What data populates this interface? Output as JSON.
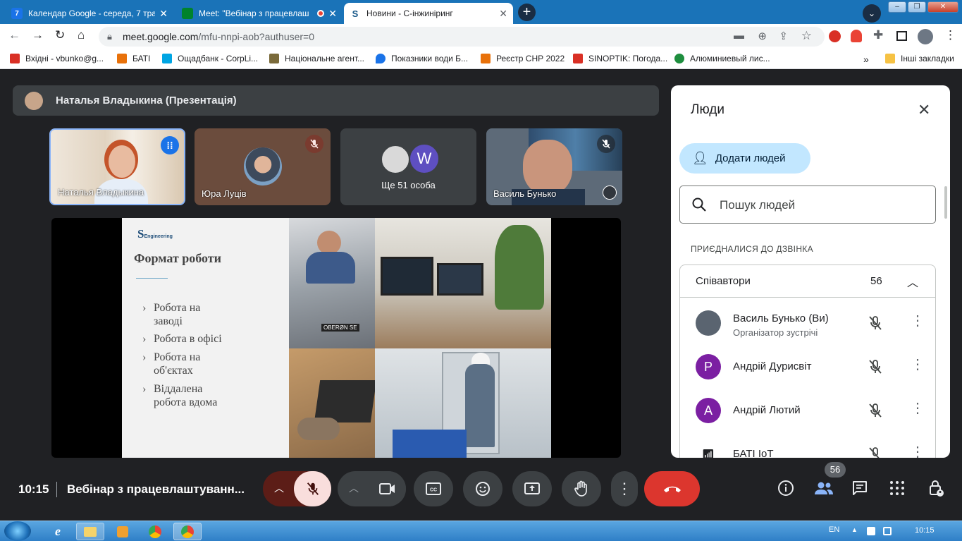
{
  "browser": {
    "tabs": [
      {
        "title": "Календар Google - середа, 7 тра",
        "favicon_text": "7",
        "favicon_color": "#1a73e8"
      },
      {
        "title": "Meet: \"Вебінар з працевлаш",
        "favicon_color": "#00832d"
      },
      {
        "title": "Новини - С-інжиніринг",
        "favicon_text": "S",
        "favicon_color": "#ffffff"
      }
    ],
    "new_tab_icon": "plus-icon",
    "url_host": "meet.google.com",
    "url_path": "/mfu-nnpi-aob?authuser=0",
    "bookmarks": [
      {
        "label": "Вхідні - vbunko@g...",
        "color": "#d93025"
      },
      {
        "label": "БАТІ",
        "color": "#e8710a"
      },
      {
        "label": "Ощадбанк - CorpLi...",
        "color": "#00a5e3"
      },
      {
        "label": "Національне агент...",
        "color": "#7a6a3a"
      },
      {
        "label": "Показники води Б...",
        "color": "#1a73e8"
      },
      {
        "label": "Реєстр СНР 2022",
        "color": "#e8710a"
      },
      {
        "label": "SINOPTIK: Погода...",
        "color": "#d93025"
      },
      {
        "label": "Алюминиевый лис...",
        "color": "#1e8e3e"
      }
    ],
    "bookmarks_more": "»",
    "other_bookmarks": "Інші закладки"
  },
  "meet": {
    "presenter_label": "Наталья Владыкина (Презентація)",
    "tiles": [
      {
        "name": "Наталья Владыкина"
      },
      {
        "name": "Юра Луців"
      },
      {
        "name": "Ще 51 особа",
        "avatar_letter": "W"
      },
      {
        "name": "Василь Бунько"
      }
    ],
    "slide": {
      "logo_text": "Engineering",
      "title": "Формат роботи",
      "bullets": [
        "Робота на заводі",
        "Робота в офісі",
        "Робота на об'єктах",
        "Віддалена робота вдома"
      ],
      "photo_text": "OBERØN SE"
    },
    "people_panel": {
      "title": "Люди",
      "add_people_label": "Додати людей",
      "search_placeholder": "Пошук людей",
      "section_label": "ПРИЄДНАЛИСЯ ДО ДЗВІНКА",
      "group_label": "Співавтори",
      "group_count": "56",
      "participants": [
        {
          "name": "Василь Бунько (Ви)",
          "role": "Організатор зустрічі",
          "avatar_letter": "",
          "avatar_color": "#5a6470"
        },
        {
          "name": "Андрій Дурисвіт",
          "role": "",
          "avatar_letter": "Р",
          "avatar_color": "#7b1fa2"
        },
        {
          "name": "Андрій Лютий",
          "role": "",
          "avatar_letter": "А",
          "avatar_color": "#7b1fa2"
        },
        {
          "name": "БАТІ IoT",
          "role": "",
          "avatar_letter": "",
          "avatar_color": "#ffffff"
        }
      ]
    },
    "bottom": {
      "time": "10:15",
      "meeting_title": "Вебінар з працевлаштуванн...",
      "people_badge": "56"
    }
  },
  "taskbar": {
    "lang": "EN",
    "clock": "10:15"
  }
}
